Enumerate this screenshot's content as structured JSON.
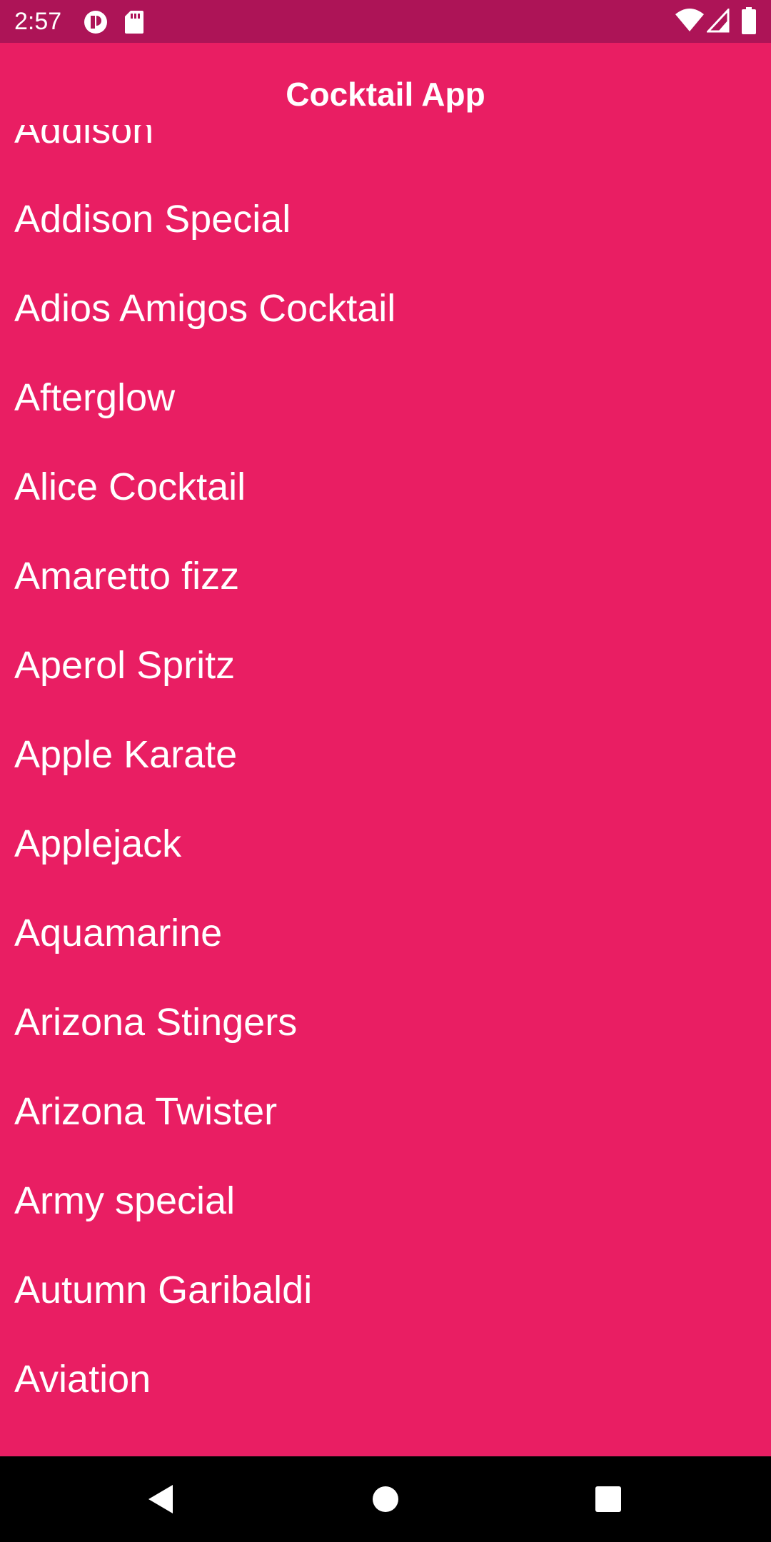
{
  "status_bar": {
    "time": "2:57",
    "background_color": "#ad1457",
    "left_icons": [
      "notification-app-icon",
      "sd-card-icon"
    ],
    "right_icons": [
      "wifi-icon",
      "cellular-signal-icon",
      "battery-icon"
    ]
  },
  "app_bar": {
    "title": "Cocktail App",
    "background_color": "#e91e63"
  },
  "cocktail_list": {
    "items": [
      "Addison",
      "Addison Special",
      "Adios Amigos Cocktail",
      "Afterglow",
      "Alice Cocktail",
      "Amaretto fizz",
      "Aperol Spritz",
      "Apple Karate",
      "Applejack",
      "Aquamarine",
      "Arizona Stingers",
      "Arizona Twister",
      "Army special",
      "Autumn Garibaldi",
      "Aviation"
    ],
    "text_color": "#ffffff"
  },
  "nav_bar": {
    "buttons": [
      "back-icon",
      "home-icon",
      "recents-icon"
    ]
  }
}
